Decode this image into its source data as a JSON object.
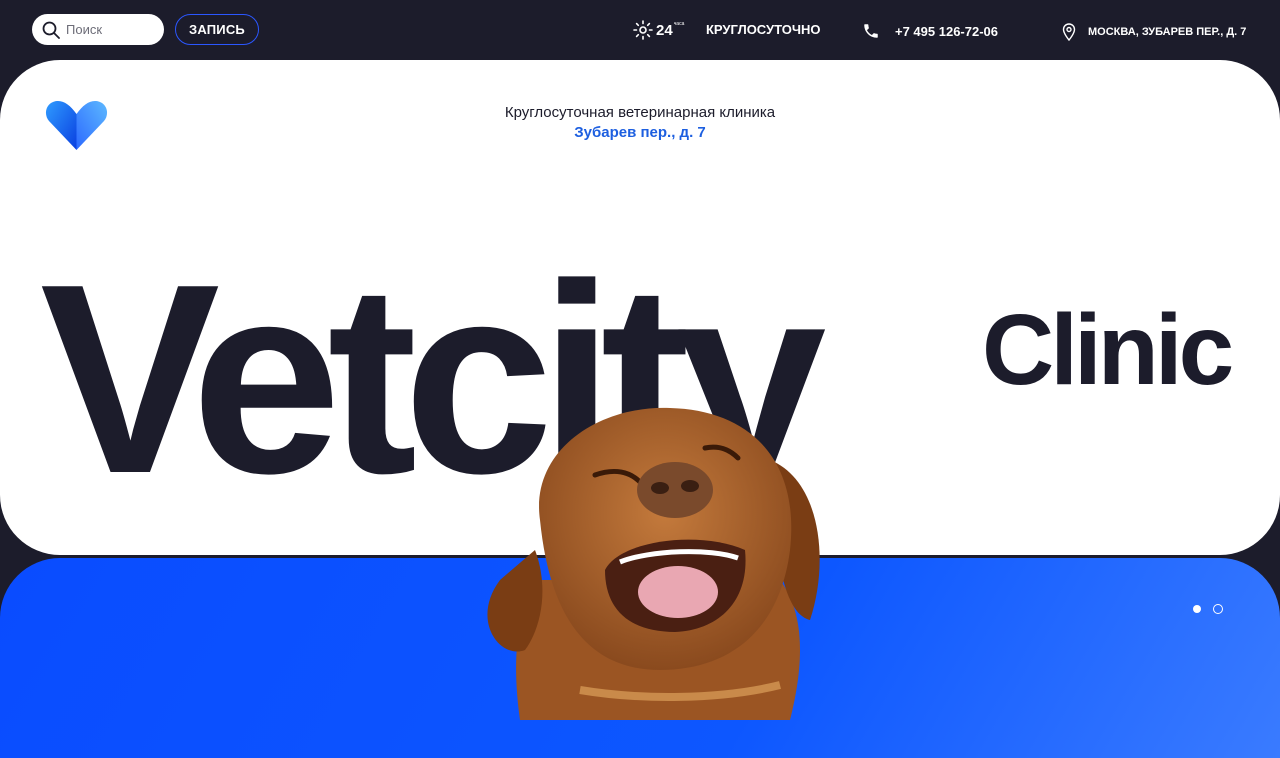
{
  "header": {
    "search_placeholder": "Поиск",
    "signup_label": "ЗАПИСЬ",
    "hours_number": "24",
    "hours_unit": "часа",
    "hours_label": "КРУГЛОСУТОЧНО",
    "phone": "+7 495 126-72-06",
    "address": "МОСКВА, ЗУБАРЕВ ПЕР., Д. 7"
  },
  "hero": {
    "subtitle": "Круглосуточная ветеринарная клиника",
    "address": "Зубарев пер., д. 7",
    "title": "Vetcity",
    "title_suffix": "Clinic"
  },
  "slider": {
    "slides": 2,
    "active_index": 0
  },
  "colors": {
    "background": "#1c1c2b",
    "accent_blue": "#0a4cff",
    "link_blue": "#1d5fe0",
    "text_dark": "#1c1c2b"
  },
  "icons": [
    "search-icon",
    "sun-24-icon",
    "phone-icon",
    "location-pin-icon",
    "vetcity-heart-logo"
  ]
}
